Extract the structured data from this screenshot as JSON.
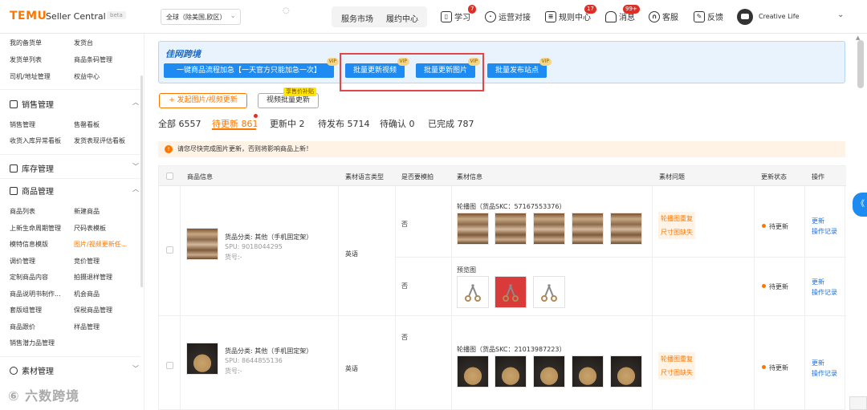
{
  "header": {
    "logo": "TEMU",
    "brand": "Seller Central",
    "beta": "beta",
    "region": "全球（除美国,欧区）",
    "nav_pill": [
      "服务市场",
      "履约中心"
    ],
    "nav": [
      {
        "label": "学习",
        "badge": "7",
        "icon": "book-icon"
      },
      {
        "label": "运营对接",
        "icon": "chat-icon"
      },
      {
        "label": "规则中心",
        "badge": "17",
        "icon": "rules-icon"
      },
      {
        "label": "消息",
        "badge": "99+",
        "icon": "bell-icon"
      },
      {
        "label": "客服",
        "icon": "headset-icon"
      },
      {
        "label": "反馈",
        "icon": "feedback-icon"
      }
    ],
    "user": "Creative Life"
  },
  "sidebar": {
    "top_items": [
      "我的备货单",
      "发货台",
      "发货单列表",
      "商品条码管理",
      "司机/地址管理",
      "权益中心"
    ],
    "sections": [
      {
        "title": "销售管理",
        "items": [
          "销售管理",
          "售罄看板",
          "收货入库异常看板",
          "发货表现评估看板"
        ]
      },
      {
        "title": "库存管理",
        "items": []
      },
      {
        "title": "商品管理",
        "items": [
          "商品列表",
          "新建商品",
          "上新生命周期管理",
          "尺码表模板",
          "模特信息模版",
          "图片/视频更新任...",
          "调价管理",
          "竞价管理",
          "定制商品内容",
          "拍摄退样管理",
          "商品说明书制作...",
          "机会商品",
          "套版组管理",
          "保税商品管理",
          "商品跟价",
          "样品管理",
          "销售潜力品管理"
        ]
      },
      {
        "title": "素材管理",
        "items": []
      }
    ]
  },
  "banner": {
    "title": "佳网跨境",
    "buttons": [
      "一键商品流程加急【一天官方只能加急一次】",
      "批量更新视频",
      "批量更新图片",
      "批量发布站点"
    ],
    "vip": "VIP"
  },
  "actions": {
    "start_update": "+ 发起图片/视频更新",
    "batch_video": "视频批量更新",
    "promo_tag": "享售价补贴"
  },
  "tabs": [
    "全部 6557",
    "待更新 861",
    "更新中 2",
    "待发布 5714",
    "待确认 0",
    "已完成 787"
  ],
  "notice": "请您尽快完成图片更新，否则将影响商品上新！",
  "table": {
    "headers": [
      "商品信息",
      "素材语言类型",
      "是否要模拍",
      "素材信息",
      "素材问题",
      "更新状态",
      "操作"
    ],
    "rows": [
      {
        "category": "货品分类: 其他（手机固定架）",
        "spu": "SPU: 9018044295",
        "sku": "货号:-",
        "language": "英语",
        "subrows": [
          {
            "model": "否",
            "media_label": "轮播图（货品SKC：57167553376）",
            "issues": [
              "轮播图重复",
              "尺寸图缺失"
            ],
            "status": "待更新",
            "ops": [
              "更新",
              "操作记录"
            ]
          },
          {
            "model": "否",
            "media_label": "预览图",
            "issues": [],
            "status": "待更新",
            "ops": [
              "更新",
              "操作记录"
            ]
          }
        ]
      },
      {
        "category": "货品分类: 其他（手机固定架）",
        "spu": "SPU: 8644855136",
        "sku": "货号:-",
        "language": "英语",
        "subrows": [
          {
            "model": "否",
            "media_label": "轮播图（货品SKC：21013987223）",
            "issues": [
              "轮播图重复",
              "尺寸图缺失"
            ],
            "status": "待更新",
            "ops": [
              "更新",
              "操作记录"
            ]
          }
        ]
      }
    ]
  },
  "watermark": "⑥ 六数跨境",
  "floater": "《",
  "colors": {
    "accent": "#fb7701",
    "primary": "#1d8bf1",
    "highlight": "#e24646"
  }
}
